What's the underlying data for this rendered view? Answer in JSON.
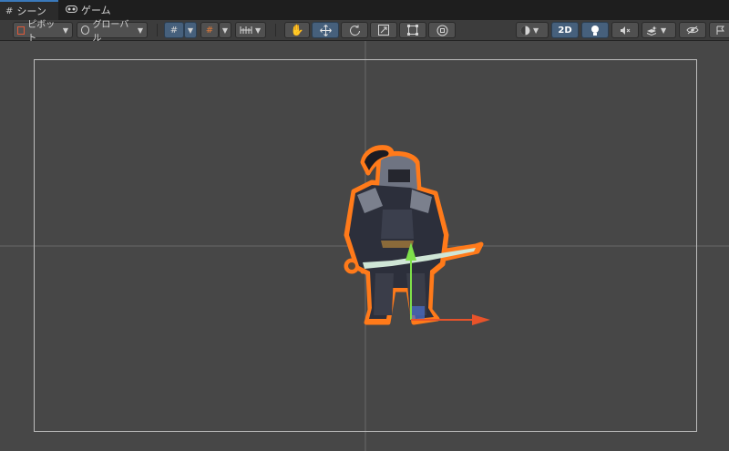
{
  "tabs": [
    {
      "label": "シーン",
      "icon": "grid-icon",
      "active": true
    },
    {
      "label": "ゲーム",
      "icon": "gamepad-icon",
      "active": false
    }
  ],
  "toolbar": {
    "pivot_label": "ピボット",
    "global_label": "グローバル",
    "mode_2d_label": "2D",
    "tools": [
      "hand-tool-icon",
      "move-tool-icon",
      "rotate-tool-icon",
      "scale-tool-icon",
      "rect-tool-icon",
      "transform-tool-icon"
    ],
    "active_tool": "move-tool-icon",
    "toggles": [
      "grid-snap-icon",
      "grid-toggle-icon",
      "increment-snap-icon",
      "shading-mode-icon",
      "lighting-icon",
      "audio-mute-icon",
      "effects-icon",
      "visibility-icon",
      "gizmos-icon"
    ]
  },
  "colors": {
    "scene_bg": "#474747",
    "selection_outline": "#ff7a1a",
    "gizmo_x": "#e8532a",
    "gizmo_y": "#7ee04a",
    "accent": "#46607c"
  }
}
